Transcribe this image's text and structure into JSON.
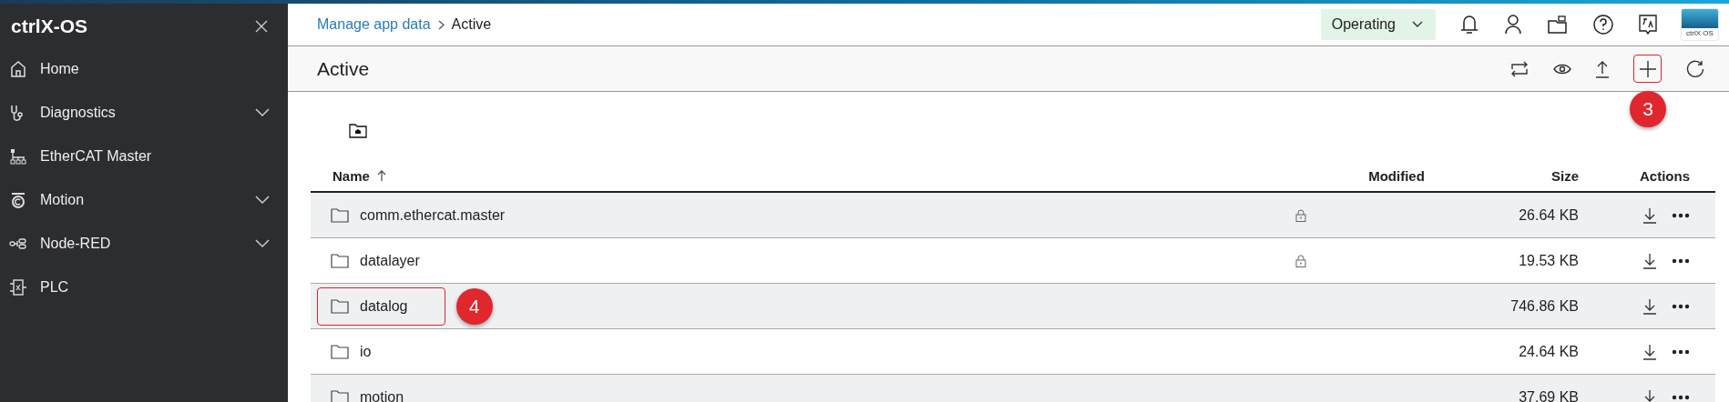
{
  "sidebar": {
    "title": "ctrlX-OS",
    "items": [
      {
        "label": "Home",
        "expandable": false
      },
      {
        "label": "Diagnostics",
        "expandable": true
      },
      {
        "label": "EtherCAT Master",
        "expandable": false
      },
      {
        "label": "Motion",
        "expandable": true
      },
      {
        "label": "Node-RED",
        "expandable": true
      },
      {
        "label": "PLC",
        "expandable": false
      }
    ]
  },
  "header": {
    "breadcrumb": [
      {
        "label": "Manage app data",
        "link": true
      },
      {
        "label": "Active",
        "link": false
      }
    ],
    "state_dropdown": "Operating",
    "logo_text": "ctrlX OS"
  },
  "page": {
    "title": "Active",
    "add_button_callout": "3"
  },
  "table": {
    "columns": [
      {
        "label": "Name",
        "sorted": true
      },
      {
        "label": "Modified",
        "sorted": false
      },
      {
        "label": "Size",
        "sorted": false
      },
      {
        "label": "Actions",
        "sorted": false
      }
    ],
    "rows": [
      {
        "name": "comm.ethercat.master",
        "locked": true,
        "size": "26.64 KB"
      },
      {
        "name": "datalayer",
        "locked": true,
        "size": "19.53 KB"
      },
      {
        "name": "datalog",
        "locked": false,
        "size": "746.86 KB",
        "callout": "4"
      },
      {
        "name": "io",
        "locked": false,
        "size": "24.64 KB"
      },
      {
        "name": "motion",
        "locked": false,
        "size": "37.69 KB"
      }
    ]
  }
}
